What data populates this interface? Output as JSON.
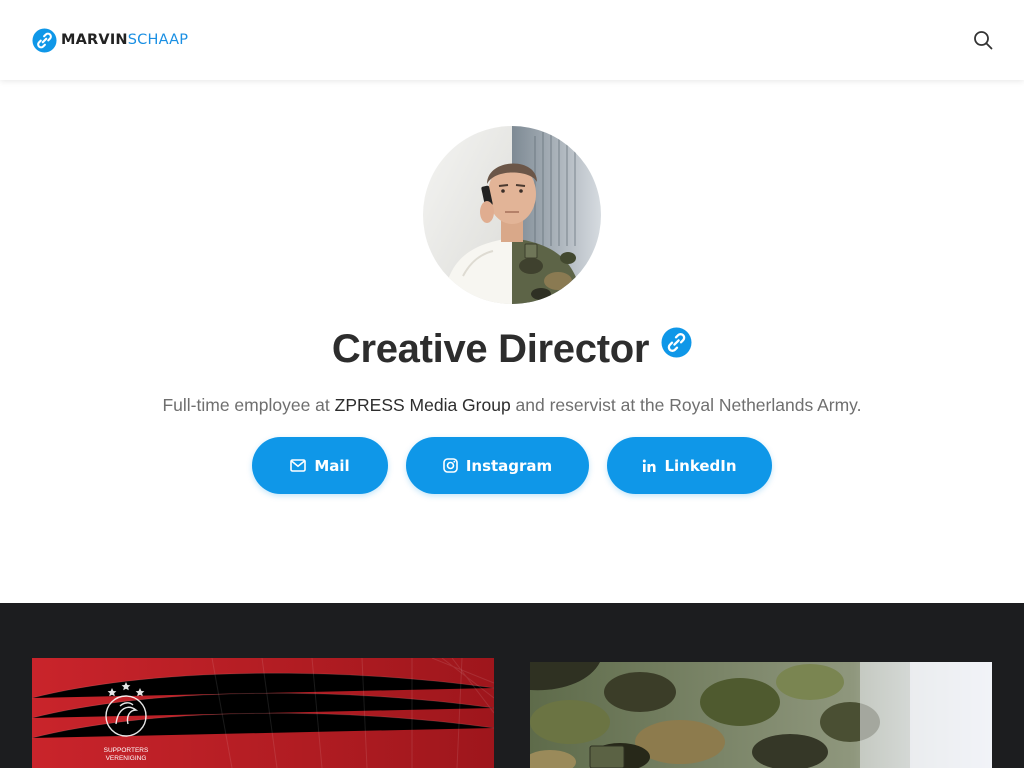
{
  "header": {
    "logo_first": "MARVIN",
    "logo_last": "SCHAAP",
    "search_icon": "search-icon"
  },
  "hero": {
    "title": "Creative Director",
    "subtitle_before": "Full-time employee at ",
    "subtitle_company": "ZPRESS Media Group",
    "subtitle_after": " and reservist at the Royal Netherlands Army."
  },
  "social": [
    {
      "label": "Mail",
      "icon": "mail-icon"
    },
    {
      "label": "Instagram",
      "icon": "instagram-icon"
    },
    {
      "label": "LinkedIn",
      "icon": "linkedin-icon"
    }
  ],
  "cards": {
    "left_logo_lines": [
      "SUPPORTERS",
      "VERENIGING"
    ]
  },
  "colors": {
    "accent": "#0f97e8",
    "dark_band": "#1c1d1f",
    "card_red": "#b11a21"
  }
}
